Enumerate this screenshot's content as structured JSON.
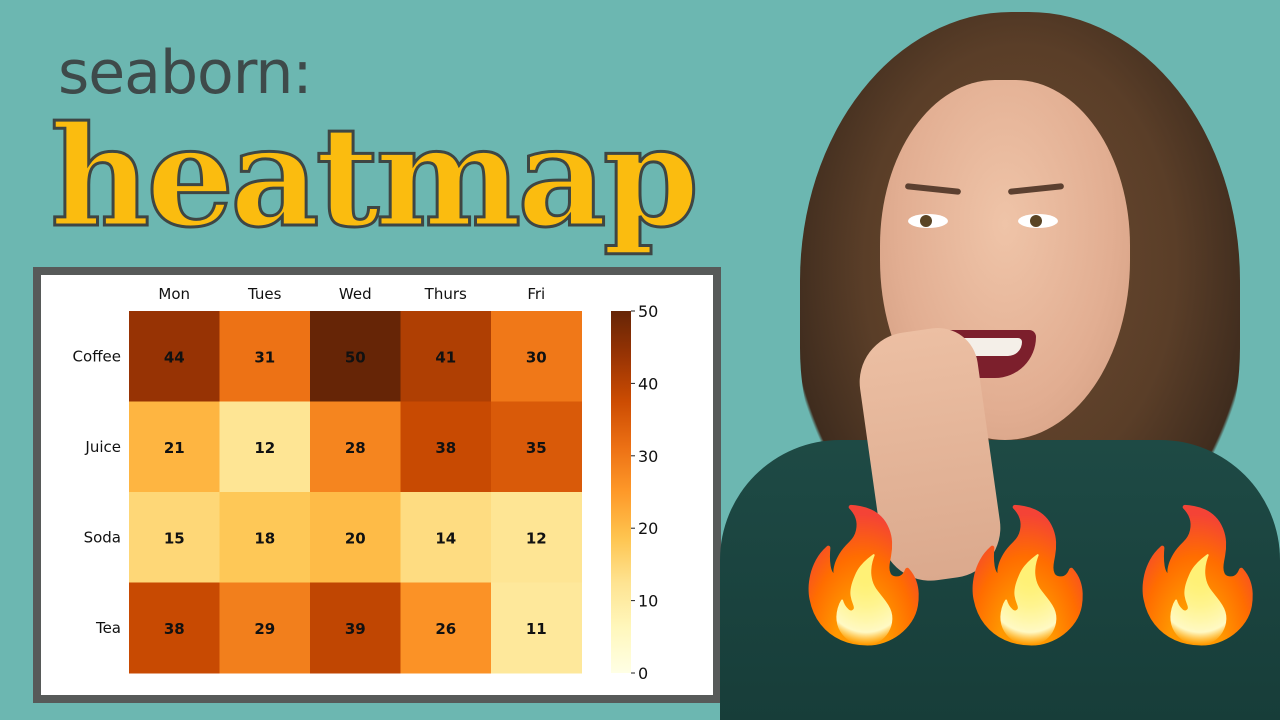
{
  "header": {
    "subtitle": "seaborn:",
    "title": "heatmap"
  },
  "decorations": {
    "flame_icon": "🔥",
    "flame_count": 3
  },
  "colors": {
    "background": "#6cb7b1",
    "title_fill": "#fbbc0f",
    "title_outline": "#3e4644",
    "frame": "#575a59"
  },
  "chart_data": {
    "type": "heatmap",
    "title": "",
    "colormap": "YlOrBr",
    "x_labels": [
      "Mon",
      "Tues",
      "Wed",
      "Thurs",
      "Fri"
    ],
    "x_label_position": "top",
    "y_labels": [
      "Coffee",
      "Juice",
      "Soda",
      "Tea"
    ],
    "values": [
      [
        44,
        31,
        50,
        41,
        30
      ],
      [
        21,
        12,
        28,
        38,
        35
      ],
      [
        15,
        18,
        20,
        14,
        12
      ],
      [
        38,
        29,
        39,
        26,
        11
      ]
    ],
    "annot": true,
    "annot_weight": "bold",
    "vmin": 0,
    "vmax": 50,
    "colorbar": {
      "ticks": [
        0,
        10,
        20,
        30,
        40,
        50
      ],
      "placement": "right"
    }
  }
}
